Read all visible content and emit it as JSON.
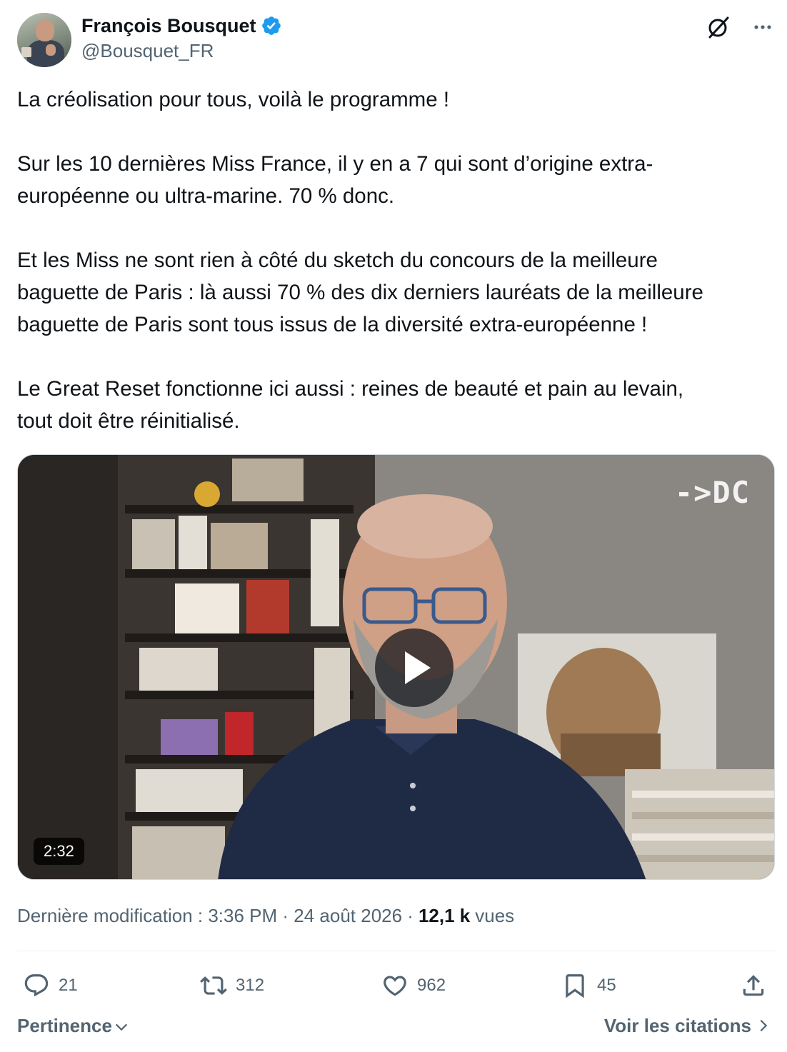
{
  "author": {
    "display_name": "François Bousquet",
    "handle": "@Bousquet_FR",
    "verified": true,
    "avatar_icon": "author-avatar-photo"
  },
  "header_icons": {
    "grok": "grok-icon",
    "more": "more-icon"
  },
  "tweet": {
    "paragraphs": [
      "La créolisation pour tous, voilà le programme !",
      "Sur les 10 dernières Miss France, il y en a 7 qui sont d’origine extra-\neuropéenne ou ultra-marine. 70 % donc.",
      "Et les Miss ne sont rien à côté du sketch du concours de la meilleure\nbaguette de Paris : là aussi 70 % des dix derniers lauréats de la meilleure\nbaguette de Paris sont tous issus de la diversité extra-européenne !",
      "Le Great Reset fonctionne ici aussi : reines de beauté et pain au levain,\ntout doit être réinitialisé."
    ]
  },
  "video": {
    "duration": "2:32",
    "watermark": "->DC"
  },
  "meta": {
    "label": "Dernière modification : 3:36 PM · 24 août 2026 ·",
    "views_count": "12,1 k",
    "views_label": "vues"
  },
  "actions": {
    "reply_count": "21",
    "retweet_count": "312",
    "like_count": "962",
    "bookmark_count": "45"
  },
  "footer": {
    "sort_label": "Pertinence",
    "quotes_label": "Voir les citations"
  },
  "colors": {
    "text": "#0f1419",
    "secondary": "#536471",
    "verified": "#1d9bf0",
    "divider": "#eff3f4"
  }
}
